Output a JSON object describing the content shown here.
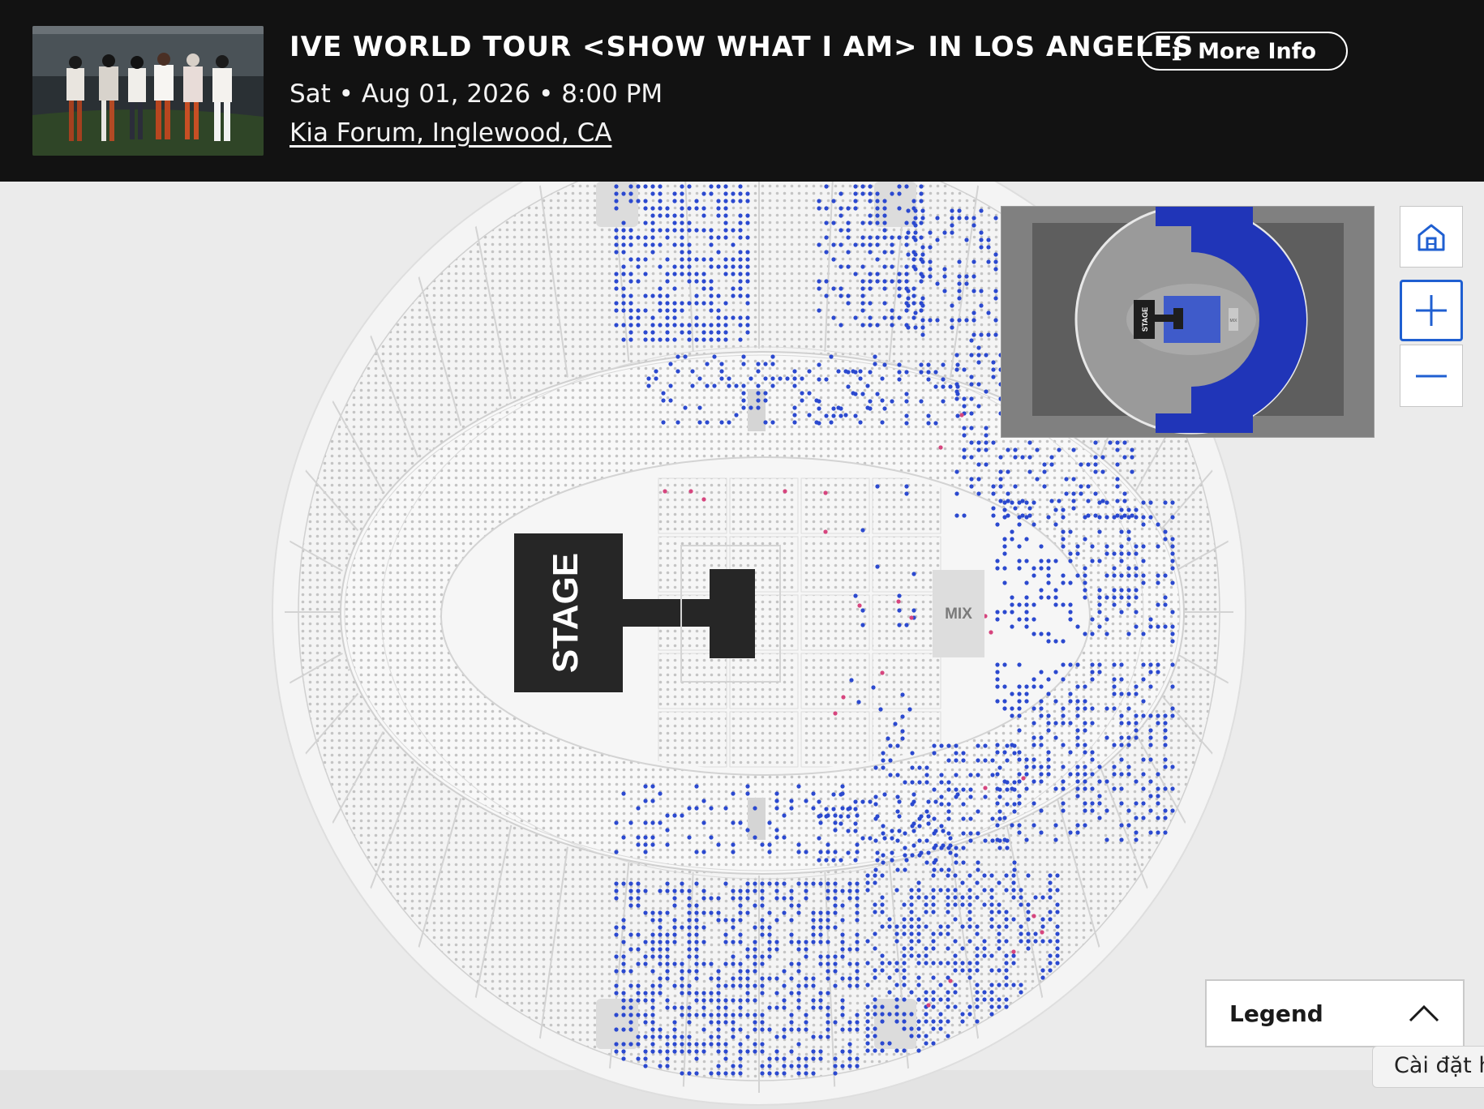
{
  "event": {
    "title": "IVE WORLD TOUR <SHOW WHAT I AM> IN LOS ANGELES",
    "date": "Sat • Aug 01, 2026 • 8:00 PM",
    "venue": "Kia Forum, Inglewood, CA",
    "more_info_label": "More Info"
  },
  "seatmap": {
    "stage_label": "STAGE",
    "mix_label": "MIX"
  },
  "minimap": {
    "stage_label": "STAGE",
    "mix_label": "MIX"
  },
  "legend": {
    "label": "Legend"
  },
  "tooltip": {
    "text": "Cài đặt h"
  },
  "colors": {
    "header_bg": "#121212",
    "available_seat": "#2b49cf",
    "resale_seat": "#d6457e",
    "unavailable_seat": "#c4c4c4",
    "stage": "#262626",
    "accent": "#1f5fd1"
  },
  "icons": {
    "more_info": "info-icon",
    "home": "home-icon",
    "zoom_in": "plus-icon",
    "zoom_out": "minus-icon",
    "legend_toggle": "chevron-up-icon"
  }
}
